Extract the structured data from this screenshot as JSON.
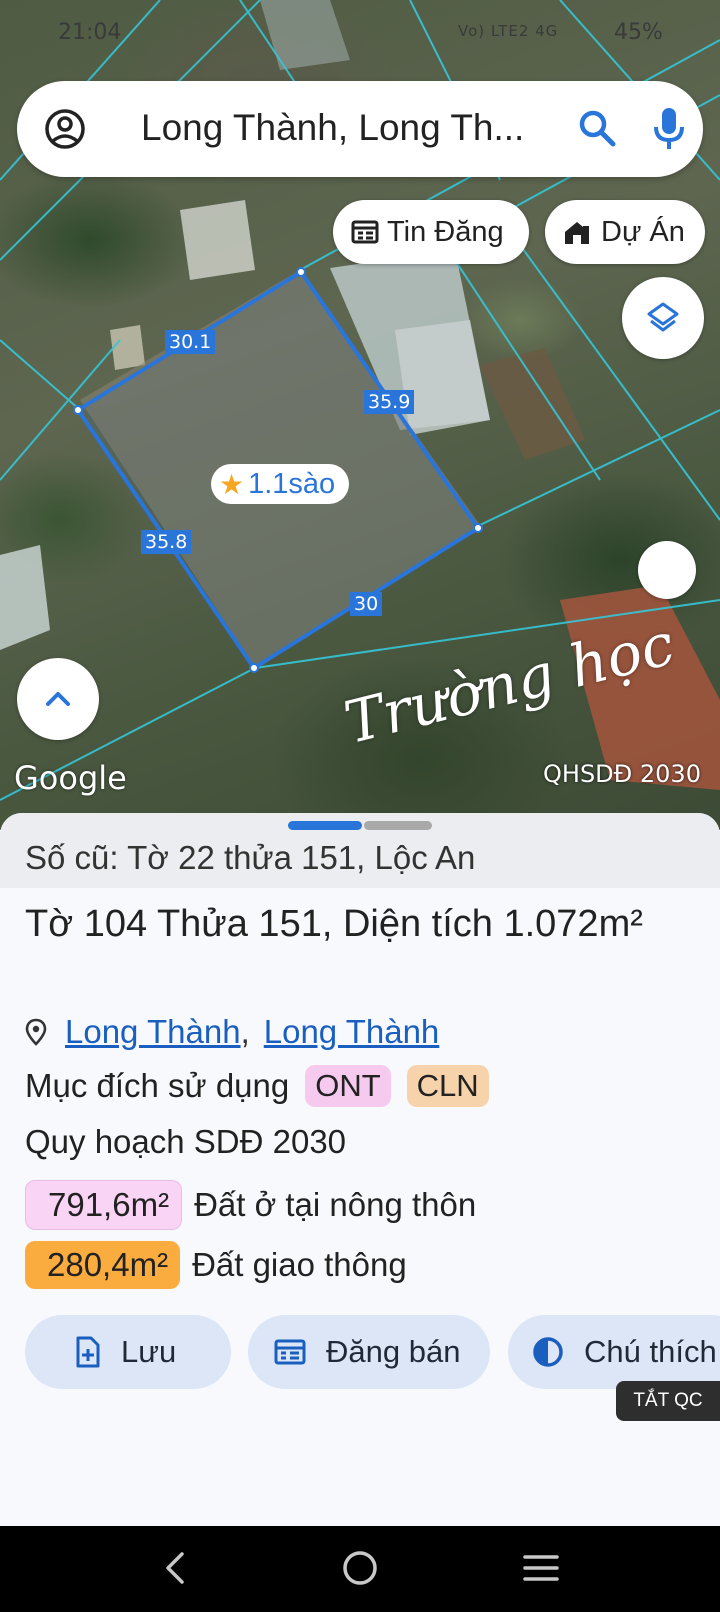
{
  "status_bar": {
    "time": "21:04",
    "signal": "Vo) LTE2 4G",
    "battery": "45%"
  },
  "search": {
    "query": "Long Thành, Long Th..."
  },
  "chips": {
    "tin_dang": "Tin Đăng",
    "du_an": "Dự Án"
  },
  "map": {
    "dimensions": [
      "30.1",
      "35.9",
      "35.8",
      "30"
    ],
    "area_label": "1.1sào",
    "google": "Google",
    "watermark": "Trường học",
    "plan_badge": "QHSDĐ 2030"
  },
  "sheet": {
    "old_ref": "Số cũ: Tờ 22 thửa 151, Lộc An",
    "title": "Tờ 104 Thửa 151, Diện tích 1.072m²",
    "location": {
      "district": "Long Thành",
      "separator": ",",
      "commune": "Long Thành"
    },
    "purpose_label": "Mục đích sử dụng",
    "purpose_codes": [
      "ONT",
      "CLN"
    ],
    "plan_title": "Quy hoạch SDĐ 2030",
    "land_uses": [
      {
        "area": "791,6m²",
        "label": "Đất ở tại nông thôn",
        "color": "#f9d4f5"
      },
      {
        "area": "280,4m²",
        "label": "Đất giao thông",
        "color": "#fbac3e"
      }
    ],
    "actions": {
      "save": "Lưu",
      "post": "Đăng bán",
      "legend": "Chú thích"
    },
    "ad_off": "TẮT QC"
  },
  "colors": {
    "accent": "#2a75d9",
    "link": "#1a5fc0",
    "button_bg": "#dce6f6"
  }
}
